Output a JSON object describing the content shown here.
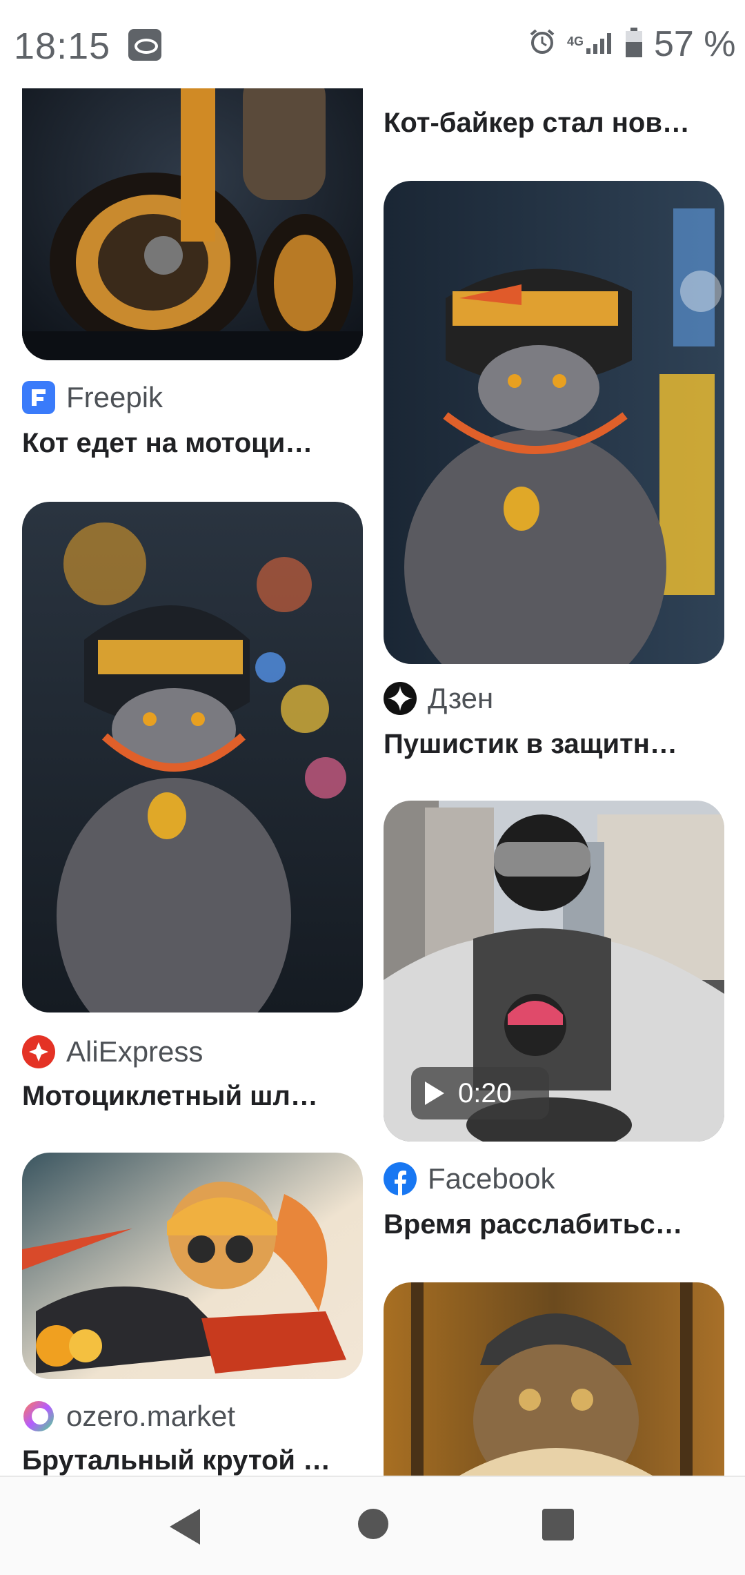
{
  "status_bar": {
    "time": "18:15",
    "network": "4G",
    "battery_percent": "57 %"
  },
  "results": [
    {
      "source": "Freepik",
      "title": "Кот едет на мотоци…",
      "icon": "freepik-logo-icon",
      "color": "#3a7bfa"
    },
    {
      "source": "",
      "title": "Кот-байкер стал нов…",
      "icon": "source-logo-icon"
    },
    {
      "source": "Дзен",
      "title": "Пушистик в защитн…",
      "icon": "dzen-logo-icon",
      "color": "#111111"
    },
    {
      "source": "AliExpress",
      "title": "Мотоциклетный шл…",
      "icon": "aliexpress-logo-icon",
      "color": "#e43225"
    },
    {
      "source": "Facebook",
      "title": "Время расслабитьс…",
      "icon": "facebook-logo-icon",
      "color": "#1877f2",
      "video_duration": "0:20"
    },
    {
      "source": "ozero.market",
      "title": "Брутальный крутой …",
      "icon": "ozero-market-logo-icon"
    }
  ],
  "nav": {
    "icons": [
      "back-icon",
      "home-icon",
      "recents-icon"
    ]
  }
}
